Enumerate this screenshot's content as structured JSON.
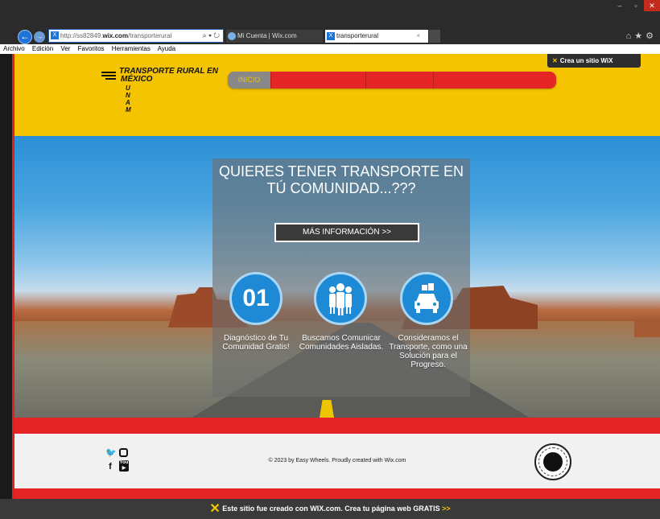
{
  "browser": {
    "address": {
      "prefix": "http://ss82849.",
      "domain": "wix.com",
      "path": "/transporterural"
    },
    "tabs": [
      {
        "label": "Mi Cuenta | Wix.com"
      },
      {
        "label": "transporterural",
        "close": "×"
      }
    ],
    "menu": [
      "Archivo",
      "Edición",
      "Ver",
      "Favoritos",
      "Herramientas",
      "Ayuda"
    ]
  },
  "site": {
    "logo": {
      "title_line1": "TRANSPORTE RURAL EN",
      "title_line2": "MÉXICO",
      "subtitle": "U N A M"
    },
    "nav": [
      {
        "label": "INICIO",
        "active": true
      },
      {
        "label": "",
        "active": false
      },
      {
        "label": "",
        "active": false
      },
      {
        "label": "",
        "active": false
      }
    ],
    "wix_badge": "Crea un sitio WiX",
    "hero": {
      "title": "QUIERES TENER TRANSPORTE EN TÚ COMUNIDAD...???",
      "button": "MÁS INFORMACIÓN >>",
      "features": [
        {
          "icon": "number-01",
          "badge": "01",
          "text": "Diagnóstico de Tu Comunidad Gratis!"
        },
        {
          "icon": "people-icon",
          "text": "Buscamos Comunicar Comunidades Aisladas."
        },
        {
          "icon": "car-icon",
          "text": "Consideramos el Transporte, como una Solución para el Progreso."
        }
      ]
    },
    "footer": {
      "copyright": "© 2023 by Easy Wheels. Proudly created with Wix.com"
    }
  },
  "wix_banner": {
    "text": "Este sitio fue creado con WIX.com. Crea tu página web GRATIS",
    "arrows": ">>"
  },
  "colors": {
    "header_yellow": "#f4c400",
    "accent_red": "#e52525",
    "icon_blue": "#1e8ad6"
  }
}
